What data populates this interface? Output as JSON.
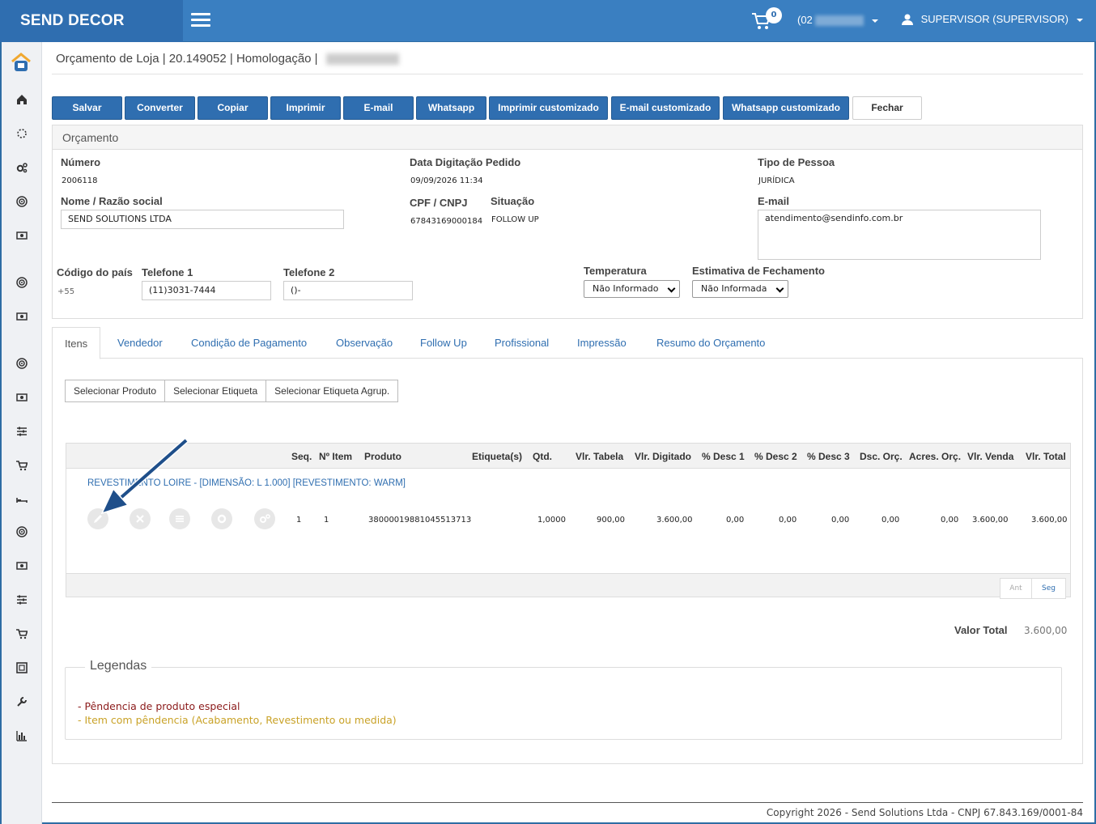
{
  "brand": "SEND DECOR",
  "header": {
    "cart_count": "0",
    "store": "(02",
    "user": "SUPERVISOR (SUPERVISOR)"
  },
  "breadcrumb": "Orçamento de Loja | 20.149052 | Homologação |",
  "toolbar": {
    "buttons": [
      "Salvar",
      "Converter",
      "Copiar",
      "Imprimir",
      "E-mail",
      "Whatsapp",
      "Imprimir customizado",
      "E-mail customizado",
      "Whatsapp customizado",
      "Fechar"
    ]
  },
  "panel": {
    "title": "Orçamento",
    "numero_label": "Número",
    "numero": "2006118",
    "data_label": "Data Digitação Pedido",
    "data": "09/09/2026 11:34",
    "tipo_label": "Tipo de Pessoa",
    "tipo": "JURÍDICA",
    "nome_label": "Nome / Razão social",
    "nome": "SEND SOLUTIONS LTDA",
    "cpf_label": "CPF / CNPJ",
    "cpf": "67843169000184",
    "situacao_label": "Situação",
    "situacao": "FOLLOW UP",
    "email_label": "E-mail",
    "email": "atendimento@sendinfo.com.br",
    "pais_label": "Código do país",
    "pais": "+55",
    "tel1_label": "Telefone 1",
    "tel1": "(11)3031-7444",
    "tel2_label": "Telefone 2",
    "tel2": "()-",
    "temperatura_label": "Temperatura",
    "temperatura": "Não Informado",
    "estimativa_label": "Estimativa de Fechamento",
    "estimativa": "Não Informada"
  },
  "tabs": [
    "Itens",
    "Vendedor",
    "Condição de Pagamento",
    "Observação",
    "Follow Up",
    "Profissional",
    "Impressão",
    "Resumo do Orçamento"
  ],
  "item_buttons": [
    "Selecionar Produto",
    "Selecionar Etiqueta",
    "Selecionar Etiqueta Agrup."
  ],
  "grid": {
    "headers": [
      "Seq.",
      "Nº Item",
      "Produto",
      "Etiqueta(s)",
      "Qtd.",
      "Vlr. Tabela",
      "Vlr. Digitado",
      "% Desc 1",
      "% Desc 2",
      "% Desc 3",
      "Dsc. Orç.",
      "Acres. Orç.",
      "Vlr. Venda",
      "Vlr. Total"
    ],
    "product_description": "REVESTIMENTO LOIRE - [DIMENSÃO: L 1.000] [REVESTIMENTO: WARM]",
    "row": {
      "seq": "1",
      "item": "1",
      "produto": "3800001988104551371​3",
      "qtd": "1,0000",
      "vlr_tabela": "900,00",
      "vlr_digitado": "3.600,00",
      "desc1": "0,00",
      "desc2": "0,00",
      "desc3": "0,00",
      "dsc_orc": "0,00",
      "acres_orc": "0,00",
      "vlr_venda": "3.600,00",
      "vlr_total": "3.600,00"
    },
    "pager_prev": "Ant",
    "pager_next": "Seg"
  },
  "total_label": "Valor Total",
  "total_value": "3.600,00",
  "legend": {
    "title": "Legendas",
    "items": [
      {
        "text": "- Pêndencia de produto especial",
        "color": "#8b1a1a"
      },
      {
        "text": "- Item com pêndencia (Acabamento, Revestimento ou medida)",
        "color": "#c9a227"
      }
    ]
  },
  "footer": "Copyright 2026 - Send Solutions Ltda - CNPJ 67.843.169/0001-84",
  "colors": {
    "primary": "#2f6eb0",
    "header": "#3a7fc1"
  }
}
